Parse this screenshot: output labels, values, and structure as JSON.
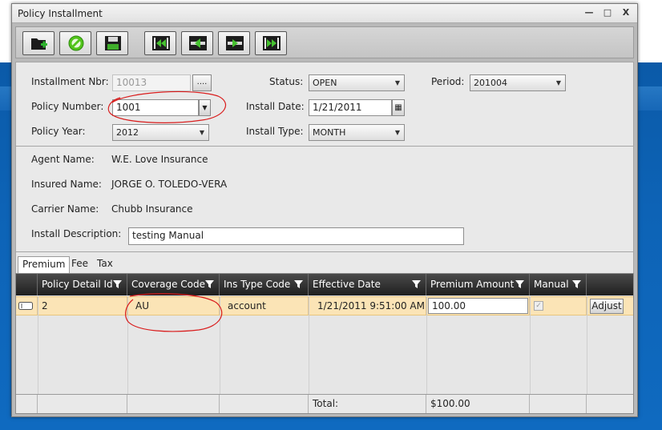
{
  "window": {
    "title": "Policy Installment",
    "controls": {
      "minimize": "—",
      "maximize": "□",
      "close": "X"
    }
  },
  "toolbar": {
    "buttons": [
      {
        "name": "new-record-button",
        "icon": "new-folder-icon"
      },
      {
        "name": "cancel-button",
        "icon": "cancel-icon"
      },
      {
        "name": "save-button",
        "icon": "save-icon"
      },
      {
        "name": "first-record-button",
        "icon": "first-record-icon"
      },
      {
        "name": "previous-record-button",
        "icon": "previous-record-icon"
      },
      {
        "name": "next-record-button",
        "icon": "next-record-icon"
      },
      {
        "name": "last-record-button",
        "icon": "last-record-icon"
      }
    ]
  },
  "form": {
    "installment_nbr": {
      "label": "Installment Nbr:",
      "value": "10013",
      "button": "...."
    },
    "policy_number": {
      "label": "Policy Number:",
      "value": "1001"
    },
    "policy_year": {
      "label": "Policy Year:",
      "value": "2012"
    },
    "status": {
      "label": "Status:",
      "value": "OPEN"
    },
    "install_date": {
      "label": "Install Date:",
      "value": "1/21/2011"
    },
    "install_type": {
      "label": "Install Type:",
      "value": "MONTH"
    },
    "period": {
      "label": "Period:",
      "value": "201004"
    }
  },
  "info": {
    "agent_name": {
      "label": "Agent Name:",
      "value": "W.E. Love Insurance"
    },
    "insured_name": {
      "label": "Insured Name:",
      "value": "JORGE O. TOLEDO-VERA"
    },
    "carrier_name": {
      "label": "Carrier Name:",
      "value": "Chubb Insurance"
    },
    "install_description": {
      "label": "Install Description:",
      "value": "testing Manual"
    }
  },
  "tabs": [
    "Premium",
    "Fee",
    "Tax"
  ],
  "grid": {
    "columns": [
      "Policy Detail Id",
      "Coverage Code",
      "Ins Type Code",
      "Effective Date",
      "Premium Amount",
      "Manual"
    ],
    "rows": [
      {
        "policy_detail_id": "2",
        "coverage_code": "AU",
        "ins_type_code": "account",
        "effective_date": "1/21/2011 9:51:00 AM",
        "premium_amount": "100.00",
        "manual": true,
        "action": "Adjust"
      }
    ],
    "footer": {
      "label": "Total:",
      "total": "$100.00"
    }
  },
  "colors": {
    "accent": "#d91c1c",
    "selected_row": "#fbe4b6",
    "header": "#2a2a2a",
    "desktop": "#0d63b6"
  }
}
